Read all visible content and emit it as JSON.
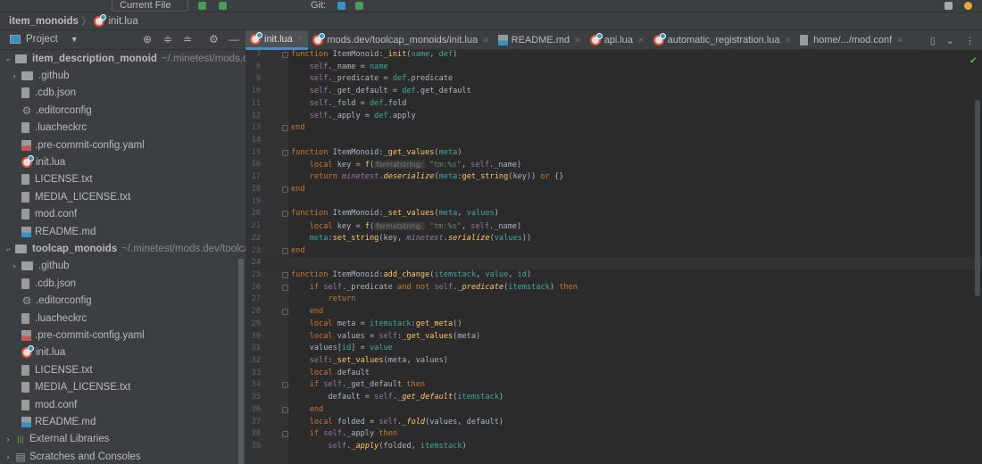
{
  "toolbar": {
    "run_config": "Current File",
    "git_label": "Git:"
  },
  "breadcrumb": {
    "project": "item_monoids",
    "file": "init.lua"
  },
  "project_panel": {
    "title": "Project"
  },
  "tabs": [
    {
      "label": "init.lua",
      "icon": "lua-icon",
      "active": true
    },
    {
      "label": "mods.dev/toolcap_monoids/init.lua",
      "icon": "lua-icon"
    },
    {
      "label": "README.md",
      "icon": "markdown-icon"
    },
    {
      "label": "api.lua",
      "icon": "lua-icon"
    },
    {
      "label": "automatic_registration.lua",
      "icon": "lua-icon"
    },
    {
      "label": "home/.../mod.conf",
      "icon": "file-icon"
    }
  ],
  "tree": [
    {
      "label": "item_description_monoid",
      "path": "~/.minetest/mods.dev",
      "type": "root",
      "depth": 0
    },
    {
      "label": ".github",
      "type": "folder",
      "depth": 1
    },
    {
      "label": ".cdb.json",
      "type": "json",
      "depth": 1
    },
    {
      "label": ".editorconfig",
      "type": "gear",
      "depth": 1
    },
    {
      "label": ".luacheckrc",
      "type": "file",
      "depth": 1
    },
    {
      "label": ".pre-commit-config.yaml",
      "type": "yaml",
      "depth": 1
    },
    {
      "label": "init.lua",
      "type": "lua",
      "depth": 1
    },
    {
      "label": "LICENSE.txt",
      "type": "file",
      "depth": 1
    },
    {
      "label": "MEDIA_LICENSE.txt",
      "type": "file",
      "depth": 1
    },
    {
      "label": "mod.conf",
      "type": "file",
      "depth": 1
    },
    {
      "label": "README.md",
      "type": "md",
      "depth": 1
    },
    {
      "label": "toolcap_monoids",
      "path": "~/.minetest/mods.dev/toolcap_",
      "type": "root",
      "depth": 0
    },
    {
      "label": ".github",
      "type": "folder",
      "depth": 1
    },
    {
      "label": ".cdb.json",
      "type": "json",
      "depth": 1
    },
    {
      "label": ".editorconfig",
      "type": "gear",
      "depth": 1
    },
    {
      "label": ".luacheckrc",
      "type": "file",
      "depth": 1
    },
    {
      "label": ".pre-commit-config.yaml",
      "type": "yaml",
      "depth": 1
    },
    {
      "label": "init.lua",
      "type": "lua",
      "depth": 1
    },
    {
      "label": "LICENSE.txt",
      "type": "file",
      "depth": 1
    },
    {
      "label": "MEDIA_LICENSE.txt",
      "type": "file",
      "depth": 1
    },
    {
      "label": "mod.conf",
      "type": "file",
      "depth": 1
    },
    {
      "label": "README.md",
      "type": "md",
      "depth": 1
    },
    {
      "label": "External Libraries",
      "type": "libs",
      "depth": 0
    },
    {
      "label": "Scratches and Consoles",
      "type": "scratch",
      "depth": 0
    }
  ],
  "editor": {
    "current_line": 24,
    "lines": [
      {
        "n": 7,
        "f": 1,
        "t": [
          [
            "kw",
            "function "
          ],
          [
            "",
            "ItemMonoid:"
          ],
          [
            "fn",
            "_init"
          ],
          [
            "",
            "("
          ],
          [
            "param",
            "name"
          ],
          [
            "",
            ", "
          ],
          [
            "param",
            "def"
          ],
          [
            "",
            ")"
          ]
        ]
      },
      {
        "n": 8,
        "t": [
          [
            "",
            "    "
          ],
          [
            "self",
            "self"
          ],
          [
            "",
            "._name = "
          ],
          [
            "param",
            "name"
          ]
        ]
      },
      {
        "n": 9,
        "t": [
          [
            "",
            "    "
          ],
          [
            "self",
            "self"
          ],
          [
            "",
            "._predicate = "
          ],
          [
            "param",
            "def"
          ],
          [
            "",
            ".predicate"
          ]
        ]
      },
      {
        "n": 10,
        "t": [
          [
            "",
            "    "
          ],
          [
            "self",
            "self"
          ],
          [
            "",
            "._get_default = "
          ],
          [
            "param",
            "def"
          ],
          [
            "",
            ".get_default"
          ]
        ]
      },
      {
        "n": 11,
        "t": [
          [
            "",
            "    "
          ],
          [
            "self",
            "self"
          ],
          [
            "",
            "._fold = "
          ],
          [
            "param",
            "def"
          ],
          [
            "",
            ".fold"
          ]
        ]
      },
      {
        "n": 12,
        "t": [
          [
            "",
            "    "
          ],
          [
            "self",
            "self"
          ],
          [
            "",
            "._apply = "
          ],
          [
            "param",
            "def"
          ],
          [
            "",
            ".apply"
          ]
        ]
      },
      {
        "n": 13,
        "f": 1,
        "t": [
          [
            "kw",
            "end"
          ]
        ]
      },
      {
        "n": 14,
        "t": []
      },
      {
        "n": 15,
        "f": 1,
        "t": [
          [
            "kw",
            "function "
          ],
          [
            "",
            "ItemMonoid:"
          ],
          [
            "fn",
            "_get_values"
          ],
          [
            "",
            "("
          ],
          [
            "param",
            "meta"
          ],
          [
            "",
            ")"
          ]
        ]
      },
      {
        "n": 16,
        "t": [
          [
            "",
            "    "
          ],
          [
            "kw",
            "local "
          ],
          [
            "",
            "key = "
          ],
          [
            "fn",
            "f"
          ],
          [
            "",
            "("
          ],
          [
            "hint",
            "formatstring:"
          ],
          [
            "str",
            " \"tm:%s\""
          ],
          [
            "",
            ", "
          ],
          [
            "self",
            "self"
          ],
          [
            "",
            "._name)"
          ]
        ]
      },
      {
        "n": 17,
        "t": [
          [
            "",
            "    "
          ],
          [
            "kw",
            "return "
          ],
          [
            "glob",
            "minetest"
          ],
          [
            "",
            "."
          ],
          [
            "ifn",
            "deserialize"
          ],
          [
            "",
            "("
          ],
          [
            "param",
            "meta"
          ],
          [
            "",
            ":"
          ],
          [
            "fn",
            "get_string"
          ],
          [
            "",
            "(key)) "
          ],
          [
            "kw",
            "or "
          ],
          [
            "",
            "{}"
          ]
        ]
      },
      {
        "n": 18,
        "f": 1,
        "t": [
          [
            "kw",
            "end"
          ]
        ]
      },
      {
        "n": 19,
        "t": []
      },
      {
        "n": 20,
        "f": 1,
        "t": [
          [
            "kw",
            "function "
          ],
          [
            "",
            "ItemMonoid:"
          ],
          [
            "fn",
            "_set_values"
          ],
          [
            "",
            "("
          ],
          [
            "param",
            "meta"
          ],
          [
            "",
            ", "
          ],
          [
            "param",
            "values"
          ],
          [
            "",
            ")"
          ]
        ]
      },
      {
        "n": 21,
        "t": [
          [
            "",
            "    "
          ],
          [
            "kw",
            "local "
          ],
          [
            "",
            "key = "
          ],
          [
            "fn",
            "f"
          ],
          [
            "",
            "("
          ],
          [
            "hint",
            "formatstring:"
          ],
          [
            "str",
            " \"tm:%s\""
          ],
          [
            "",
            ", "
          ],
          [
            "self",
            "self"
          ],
          [
            "",
            "._name)"
          ]
        ]
      },
      {
        "n": 22,
        "t": [
          [
            "",
            "    "
          ],
          [
            "param",
            "meta"
          ],
          [
            "",
            ":"
          ],
          [
            "fn",
            "set_string"
          ],
          [
            "",
            "(key, "
          ],
          [
            "glob",
            "minetest"
          ],
          [
            "",
            "."
          ],
          [
            "ifn",
            "serialize"
          ],
          [
            "",
            "("
          ],
          [
            "param",
            "values"
          ],
          [
            "",
            "))"
          ]
        ]
      },
      {
        "n": 23,
        "f": 1,
        "t": [
          [
            "kw",
            "end"
          ]
        ]
      },
      {
        "n": 24,
        "t": []
      },
      {
        "n": 25,
        "f": 1,
        "t": [
          [
            "kw",
            "function "
          ],
          [
            "",
            "ItemMonoid:"
          ],
          [
            "fn",
            "add_change"
          ],
          [
            "",
            "("
          ],
          [
            "param",
            "itemstack"
          ],
          [
            "",
            ", "
          ],
          [
            "param",
            "value"
          ],
          [
            "",
            ", "
          ],
          [
            "param",
            "id"
          ],
          [
            "",
            ")"
          ]
        ]
      },
      {
        "n": 26,
        "f": 1,
        "t": [
          [
            "",
            "    "
          ],
          [
            "kw",
            "if "
          ],
          [
            "self",
            "self"
          ],
          [
            "",
            "._predicate "
          ],
          [
            "kw",
            "and not "
          ],
          [
            "self",
            "self"
          ],
          [
            "",
            "."
          ],
          [
            "ifn",
            "_predicate"
          ],
          [
            "",
            "("
          ],
          [
            "param",
            "itemstack"
          ],
          [
            "",
            ") "
          ],
          [
            "kw",
            "then"
          ]
        ]
      },
      {
        "n": 27,
        "t": [
          [
            "",
            "        "
          ],
          [
            "kw",
            "return"
          ]
        ]
      },
      {
        "n": 28,
        "f": 1,
        "t": [
          [
            "",
            "    "
          ],
          [
            "kw",
            "end"
          ]
        ]
      },
      {
        "n": 29,
        "t": [
          [
            "",
            "    "
          ],
          [
            "kw",
            "local "
          ],
          [
            "",
            "meta = "
          ],
          [
            "param",
            "itemstack"
          ],
          [
            "",
            ":"
          ],
          [
            "fn",
            "get_meta"
          ],
          [
            "",
            "()"
          ]
        ]
      },
      {
        "n": 30,
        "t": [
          [
            "",
            "    "
          ],
          [
            "kw",
            "local "
          ],
          [
            "",
            "values = "
          ],
          [
            "self",
            "self"
          ],
          [
            "",
            ":"
          ],
          [
            "fn",
            "_get_values"
          ],
          [
            "",
            "(meta)"
          ]
        ]
      },
      {
        "n": 31,
        "t": [
          [
            "",
            "    values["
          ],
          [
            "param",
            "id"
          ],
          [
            "",
            "] = "
          ],
          [
            "param",
            "value"
          ]
        ]
      },
      {
        "n": 32,
        "t": [
          [
            "",
            "    "
          ],
          [
            "self",
            "self"
          ],
          [
            "",
            ":"
          ],
          [
            "fn",
            "_set_values"
          ],
          [
            "",
            "(meta, values)"
          ]
        ]
      },
      {
        "n": 33,
        "t": [
          [
            "",
            "    "
          ],
          [
            "kw",
            "local "
          ],
          [
            "",
            "default"
          ]
        ]
      },
      {
        "n": 34,
        "f": 1,
        "t": [
          [
            "",
            "    "
          ],
          [
            "kw",
            "if "
          ],
          [
            "self",
            "self"
          ],
          [
            "",
            "._get_default "
          ],
          [
            "kw",
            "then"
          ]
        ]
      },
      {
        "n": 35,
        "t": [
          [
            "",
            "        default = "
          ],
          [
            "self",
            "self"
          ],
          [
            "",
            "."
          ],
          [
            "ifn",
            "_get_default"
          ],
          [
            "",
            "("
          ],
          [
            "param",
            "itemstack"
          ],
          [
            "",
            ")"
          ]
        ]
      },
      {
        "n": 36,
        "f": 1,
        "t": [
          [
            "",
            "    "
          ],
          [
            "kw",
            "end"
          ]
        ]
      },
      {
        "n": 37,
        "t": [
          [
            "",
            "    "
          ],
          [
            "kw",
            "local "
          ],
          [
            "",
            "folded = "
          ],
          [
            "self",
            "self"
          ],
          [
            "",
            "."
          ],
          [
            "ifn",
            "_fold"
          ],
          [
            "",
            "(values, default)"
          ]
        ]
      },
      {
        "n": 38,
        "f": 1,
        "t": [
          [
            "",
            "    "
          ],
          [
            "kw",
            "if "
          ],
          [
            "self",
            "self"
          ],
          [
            "",
            "._apply "
          ],
          [
            "kw",
            "then"
          ]
        ]
      },
      {
        "n": 39,
        "t": [
          [
            "",
            "        "
          ],
          [
            "self",
            "self"
          ],
          [
            "",
            "."
          ],
          [
            "ifn",
            "_apply"
          ],
          [
            "",
            "(folded, "
          ],
          [
            "param",
            "itemstack"
          ],
          [
            "",
            ")"
          ]
        ]
      }
    ]
  },
  "colors": {
    "accent": "#4a88c7",
    "keyword": "#cc7832",
    "self": "#9876aa",
    "param": "#3fa9a0",
    "function": "#ffc66d",
    "string": "#6a8759"
  }
}
